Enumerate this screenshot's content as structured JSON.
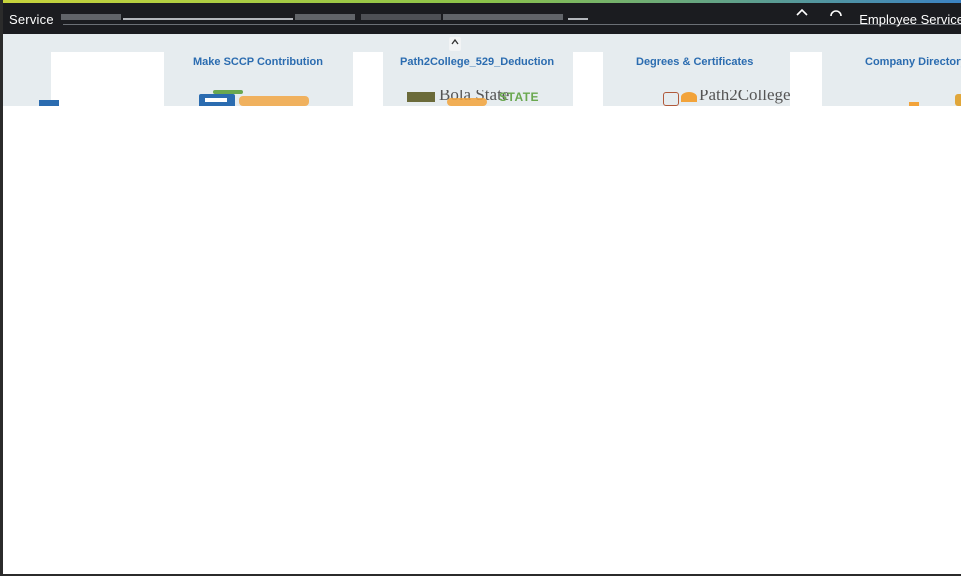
{
  "header": {
    "product_title": "Service",
    "page_name": "Employee Service",
    "icons": [
      "chevron-up-icon",
      "search-icon"
    ],
    "colors": {
      "bar": "#1b1c20",
      "accent": "#3a82c4"
    }
  },
  "tiles": [
    {
      "label": "Make SCCP Contribution"
    },
    {
      "label": "Path2College_529_Deduction"
    },
    {
      "label": "Degrees & Certificates"
    },
    {
      "label": "Company Directory"
    }
  ],
  "logos": {
    "path2college": "Path2College",
    "state": "STATE",
    "state_fragment": "Bola State"
  },
  "scroll": {
    "icon": "chevron-up-icon"
  }
}
